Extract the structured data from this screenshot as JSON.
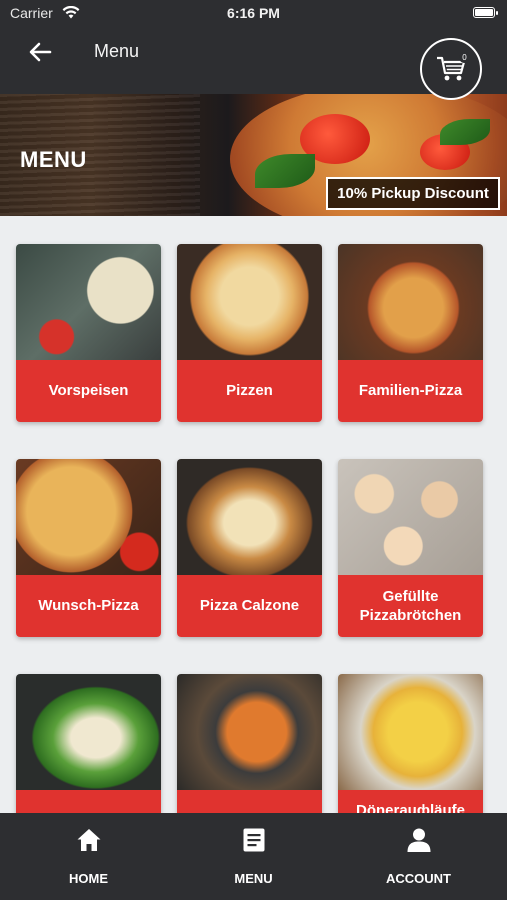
{
  "status_bar": {
    "carrier": "Carrier",
    "time": "6:16 PM"
  },
  "app_bar": {
    "title": "Menu",
    "cart_count": "0"
  },
  "banner": {
    "title": "MENU",
    "discount": "10% Pickup Discount"
  },
  "categories": [
    {
      "label": "Vorspeisen"
    },
    {
      "label": "Pizzen"
    },
    {
      "label": "Familien-Pizza"
    },
    {
      "label": "Wunsch-Pizza"
    },
    {
      "label": "Pizza Calzone"
    },
    {
      "label": "Gefüllte Pizzabrötchen"
    },
    {
      "label": ""
    },
    {
      "label": ""
    },
    {
      "label": "Dönerauфläufe"
    }
  ],
  "tab_bar": {
    "items": [
      {
        "label": "HOME",
        "icon": "home-icon"
      },
      {
        "label": "MENU",
        "icon": "menu-list-icon"
      },
      {
        "label": "ACCOUNT",
        "icon": "user-icon"
      }
    ]
  },
  "colors": {
    "bar_dark": "#2d2e31",
    "accent_red": "#e0332f",
    "background": "#eceef0"
  }
}
